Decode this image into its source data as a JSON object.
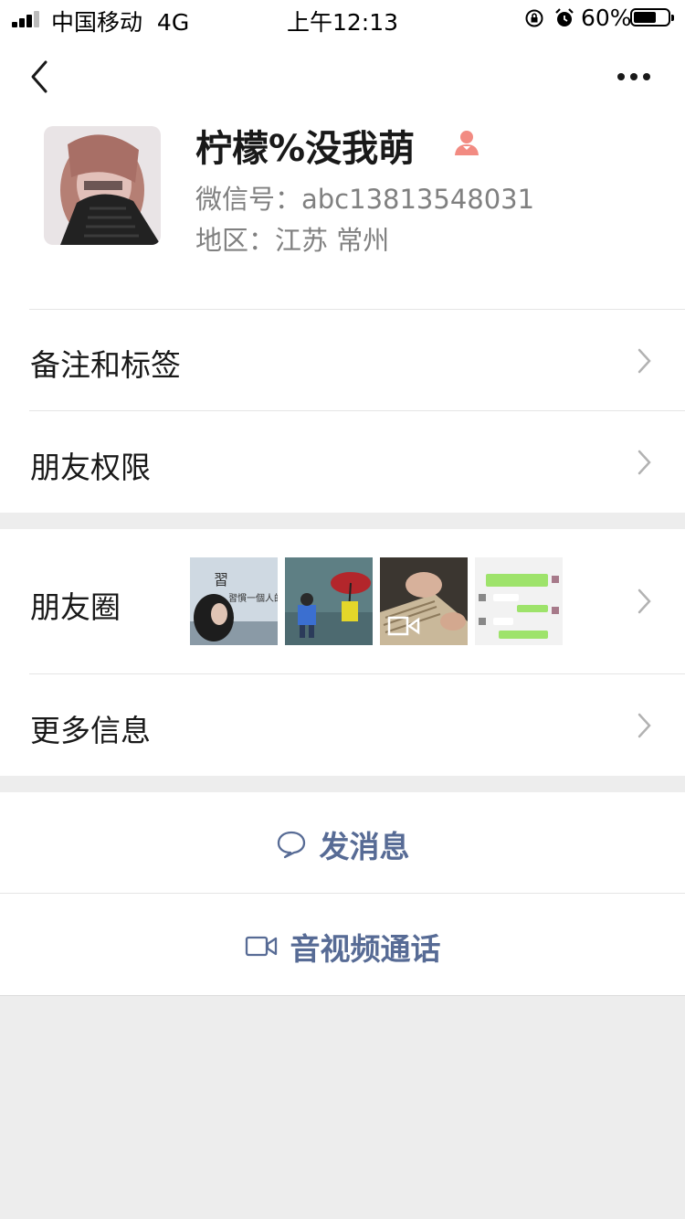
{
  "status_bar": {
    "carrier": "中国移动",
    "network": "4G",
    "time": "上午12:13",
    "battery_percent": "60%",
    "battery_level": 0.6,
    "icons": [
      "signal-icon",
      "rotation-lock-icon",
      "alarm-icon",
      "battery-icon"
    ]
  },
  "header": {
    "back_icon": "chevron-left-icon",
    "more_icon": "more-dots-icon"
  },
  "profile": {
    "name": "柠檬%没我萌",
    "gender_icon": "female-icon",
    "gender_color": "#fa5151",
    "wechat_id": "微信号：abc13813548031",
    "region": "地区：江苏 常州"
  },
  "menu": {
    "remarks_tags": "备注和标签",
    "friend_permissions": "朋友权限",
    "moments": "朋友圈",
    "more_info": "更多信息"
  },
  "moments_thumbnails": [
    {
      "name": "moments-thumb-1",
      "text": "習慣一個人的世界"
    },
    {
      "name": "moments-thumb-2"
    },
    {
      "name": "moments-thumb-3",
      "has_video": true
    },
    {
      "name": "moments-thumb-4"
    }
  ],
  "actions": {
    "send_message": "发消息",
    "video_call": "音视频通话"
  },
  "colors": {
    "link_blue": "#576b95",
    "background": "#ededed",
    "secondary_text": "#808080"
  }
}
